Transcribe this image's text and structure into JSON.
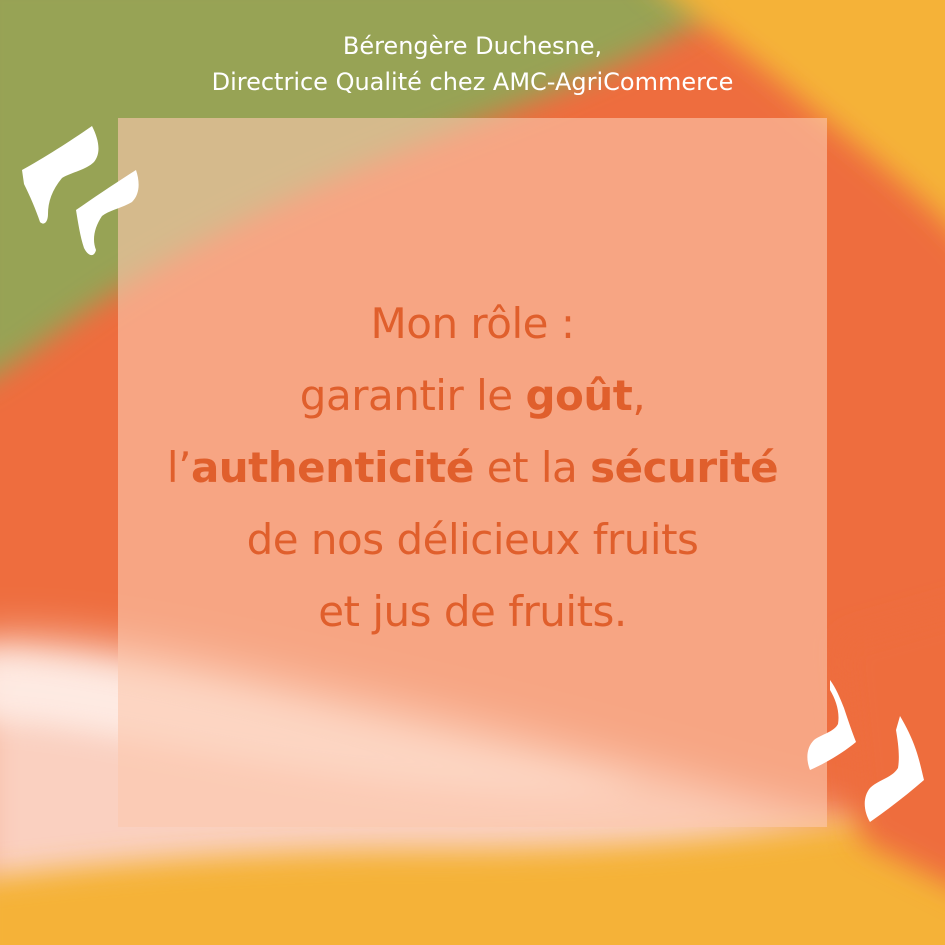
{
  "colors": {
    "green": "#97a355",
    "orange": "#ee6d3e",
    "yellow": "#f5b238",
    "peach": "#fcc8ae",
    "pink": "#fad0c0",
    "text_orange": "#e05f2c",
    "white": "#ffffff"
  },
  "attribution": {
    "name": "Bérengère Duchesne,",
    "role": "Directrice Qualité chez AMC-AgriCommerce"
  },
  "quote": {
    "line1": "Mon rôle :",
    "line2_pre": "garantir le ",
    "line2_bold": "goût",
    "line2_post": ",",
    "line3_pre": "l’",
    "line3_bold1": "authenticité",
    "line3_mid": " et la ",
    "line3_bold2": "sécurité",
    "line4": "de nos délicieux fruits",
    "line5": "et jus de fruits."
  },
  "icons": {
    "open_quote": "open-quote-icon",
    "close_quote": "close-quote-icon"
  }
}
